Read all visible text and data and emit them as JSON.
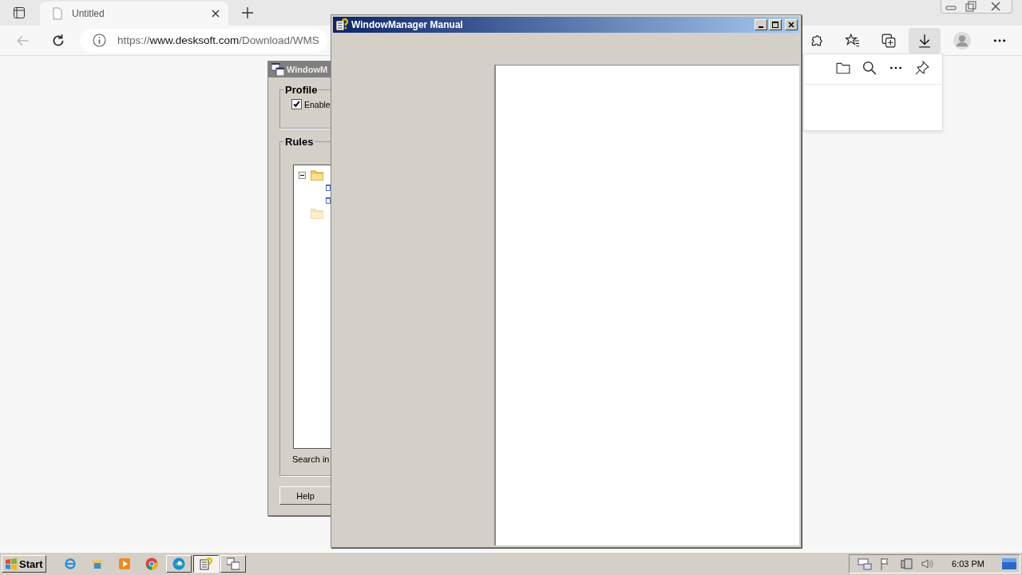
{
  "browser": {
    "tabs": [
      {
        "label": "Untitled",
        "selected": true
      }
    ],
    "address": {
      "scheme": "https://",
      "host": "www.desksoft.com",
      "path": "/Download/WMS"
    }
  },
  "back_window": {
    "title": "WindowM",
    "profile_group": "Profile",
    "enable_checkbox": {
      "label": "Enable",
      "checked": true
    },
    "rules_group": "Rules",
    "tree": [
      {
        "kind": "folder",
        "enabled": true,
        "expanded": true,
        "children": [
          {
            "kind": "rule"
          },
          {
            "kind": "rule"
          }
        ]
      },
      {
        "kind": "folder",
        "enabled": false
      }
    ],
    "search_label": "Search in",
    "help_button": "Help"
  },
  "manual_window": {
    "title": "WindowManager Manual"
  },
  "taskbar": {
    "start": "Start",
    "apps": [
      {
        "kind": "ie",
        "selected": false
      },
      {
        "kind": "explorer",
        "selected": false
      },
      {
        "kind": "media",
        "selected": false
      },
      {
        "kind": "chrome",
        "selected": false
      },
      {
        "kind": "edge",
        "selected": false
      },
      {
        "kind": "help",
        "selected": true
      },
      {
        "kind": "wm",
        "selected": false
      }
    ],
    "clock": "6:03 PM"
  }
}
